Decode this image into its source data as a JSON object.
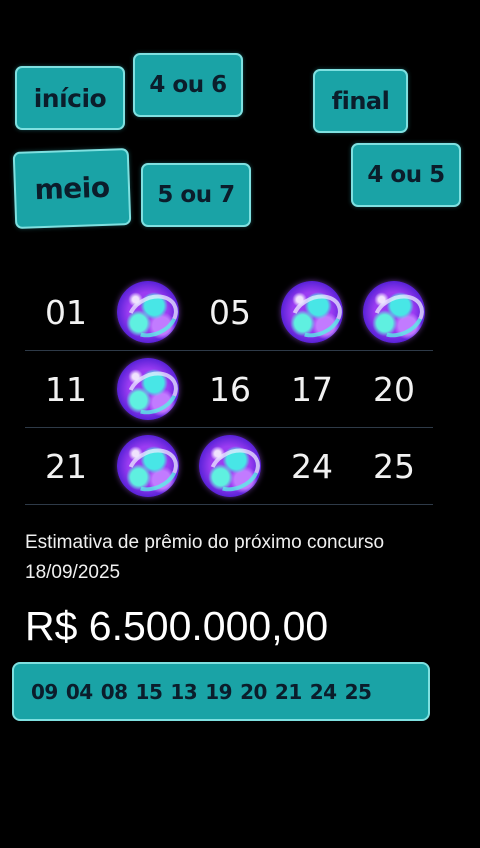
{
  "tags": {
    "inicio": "início",
    "four_or_six": "4 ou 6",
    "final": "final",
    "meio": "meio",
    "five_or_seven": "5 ou 7",
    "four_or_five": "4 ou 5"
  },
  "grid": {
    "rows": [
      [
        "01",
        "●",
        "05",
        "●",
        "●"
      ],
      [
        "11",
        "●",
        "16",
        "17",
        "20"
      ],
      [
        "21",
        "●",
        "●",
        "24",
        "25"
      ]
    ],
    "ball_color": "#9b3cf2",
    "ball_accent": "#48e6e6"
  },
  "estimate": {
    "label": "Estimativa de prêmio do próximo concurso",
    "date": "18/09/2025",
    "prize": "R$ 6.500.000,00"
  },
  "result": {
    "numbers": [
      "09",
      "04",
      "08",
      "15",
      "13",
      "19",
      "20",
      "21",
      "24",
      "25"
    ]
  },
  "colors": {
    "background": "#000000",
    "tag_fill": "#1aa3a6",
    "tag_border": "#7fe0e0",
    "tag_text": "#0b1d2b"
  }
}
